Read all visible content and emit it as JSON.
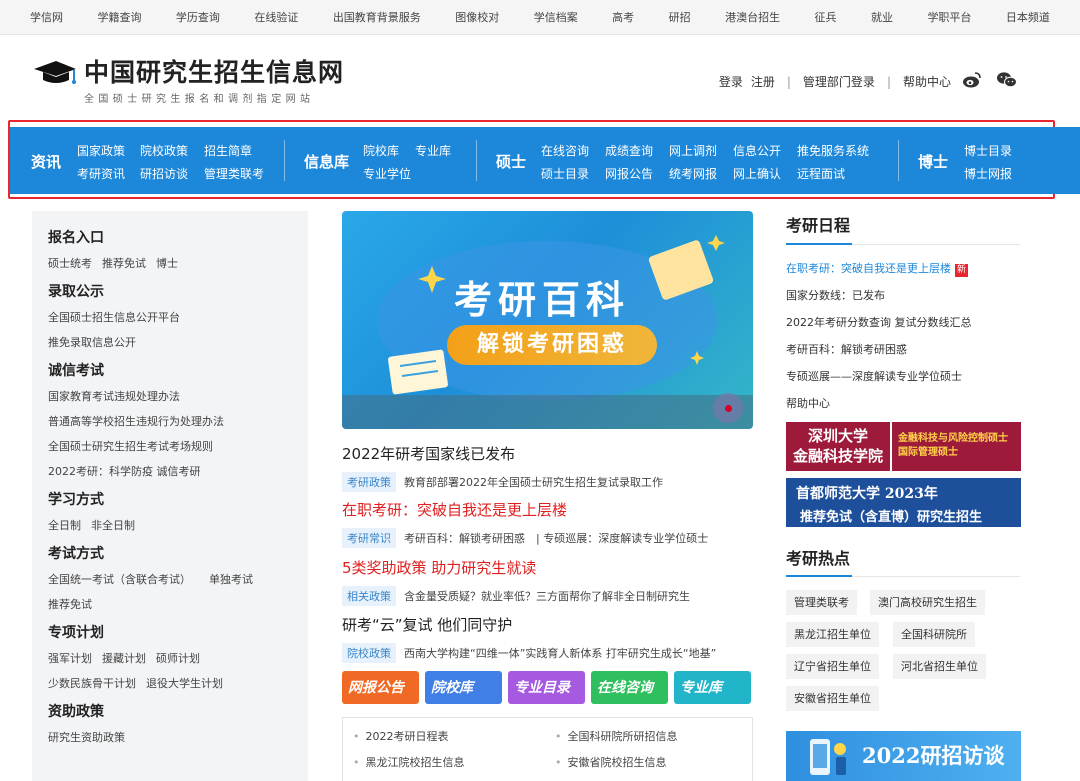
{
  "topbar": [
    "学信网",
    "学籍查询",
    "学历查询",
    "在线验证",
    "出国教育背景服务",
    "图像校对",
    "学信档案",
    "高考",
    "研招",
    "港澳台招生",
    "征兵",
    "就业",
    "学职平台",
    "日本频道"
  ],
  "header": {
    "title": "中国研究生招生信息网",
    "subtitle": "全国硕士研究生报名和调剂指定网站",
    "login": "登录",
    "register": "注册",
    "admin_login": "管理部门登录",
    "help": "帮助中心"
  },
  "nav": {
    "zixun": {
      "label": "资讯",
      "links": [
        "国家政策",
        "院校政策",
        "招生简章",
        "考研资讯",
        "研招访谈",
        "管理类联考"
      ]
    },
    "xinxiku": {
      "label": "信息库",
      "links": [
        "院校库",
        "专业库",
        "专业学位"
      ]
    },
    "shuoshi": {
      "label": "硕士",
      "links": [
        "在线咨询",
        "成绩查询",
        "网上调剂",
        "信息公开",
        "推免服务系统",
        "硕士目录",
        "网报公告",
        "统考网报",
        "网上确认",
        "远程面试"
      ]
    },
    "boshi": {
      "label": "博士",
      "links": [
        "博士目录",
        "博士网报"
      ]
    }
  },
  "left": {
    "sections": [
      {
        "title": "报名入口",
        "rows": [
          [
            "硕士统考",
            "推荐免试",
            "博士"
          ]
        ]
      },
      {
        "title": "录取公示",
        "rows": [
          [
            "全国硕士招生信息公开平台"
          ],
          [
            "推免录取信息公开"
          ]
        ]
      },
      {
        "title": "诚信考试",
        "rows": [
          [
            "国家教育考试违规处理办法"
          ],
          [
            "普通高等学校招生违规行为处理办法"
          ],
          [
            "全国硕士研究生招生考试考场规则"
          ],
          [
            "2022考研：科学防疫 诚信考研"
          ]
        ]
      },
      {
        "title": "学习方式",
        "rows": [
          [
            "全日制",
            "非全日制"
          ]
        ]
      },
      {
        "title": "考试方式",
        "rows": [
          [
            "全国统一考试（含联合考试）",
            "单独考试"
          ],
          [
            "推荐免试"
          ]
        ]
      },
      {
        "title": "专项计划",
        "rows": [
          [
            "强军计划",
            "援藏计划",
            "硕师计划"
          ],
          [
            "少数民族骨干计划",
            "退役大学生计划"
          ]
        ]
      },
      {
        "title": "资助政策",
        "rows": [
          [
            "研究生资助政策"
          ]
        ]
      }
    ]
  },
  "banner": {
    "title": "考研百科",
    "pill": "解锁考研困惑"
  },
  "news": [
    {
      "title": "2022年研考国家线已发布",
      "red": false,
      "tag": "考研政策",
      "sub": "教育部部署2022年全国硕士研究生招生复试录取工作"
    },
    {
      "title": "在职考研：突破自我还是更上层楼",
      "red": true,
      "tag": "考研常识",
      "sub": "考研百科：解锁考研困惑　| 专硕巡展：深度解读专业学位硕士"
    },
    {
      "title": "5类奖助政策 助力研究生就读",
      "red": true,
      "tag": "相关政策",
      "sub": "含金量受质疑？就业率低？三方面帮你了解非全日制研究生"
    },
    {
      "title": "研考“云”复试 他们同守护",
      "red": false,
      "tag": "院校政策",
      "sub": "西南大学构建“四维一体”实践育人新体系 打牢研究生成长“地基”"
    }
  ],
  "tiles": [
    {
      "label": "网报公告",
      "color": "#f06a25"
    },
    {
      "label": "院校库",
      "color": "#3f7fe6"
    },
    {
      "label": "专业目录",
      "color": "#a55ae0"
    },
    {
      "label": "在线咨询",
      "color": "#2fbf5f"
    },
    {
      "label": "专业库",
      "color": "#22b4c8"
    }
  ],
  "quicklinks": [
    "2022考研日程表",
    "全国科研院所研招信息",
    "黑龙江院校招生信息",
    "安徽省院校招生信息"
  ],
  "right": {
    "schedule_title": "考研日程",
    "schedule": [
      {
        "text": "在职考研：突破自我还是更上层楼",
        "new": "新"
      },
      {
        "text": "国家分数线：已发布"
      },
      {
        "text": "2022年考研分数查询 复试分数线汇总"
      },
      {
        "text": "考研百科：解锁考研困惑"
      },
      {
        "text": "专硕巡展——深度解读专业学位硕士"
      },
      {
        "text": "帮助中心"
      }
    ],
    "ad1": {
      "left1": "深圳大学",
      "left2": "金融科技学院",
      "right1": "金融科技与风险控制硕士",
      "right2": "国际管理硕士"
    },
    "ad2": {
      "line1": "首都师范大学 2023年",
      "line2": "推荐免试（含直博）研究生招生"
    },
    "hot_title": "考研热点",
    "hot": [
      "管理类联考",
      "澳门高校研究生招生",
      "黑龙江招生单位",
      "全国科研院所",
      "辽宁省招生单位",
      "河北省招生单位",
      "安徽省招生单位"
    ],
    "ad3": "2022研招访谈"
  }
}
